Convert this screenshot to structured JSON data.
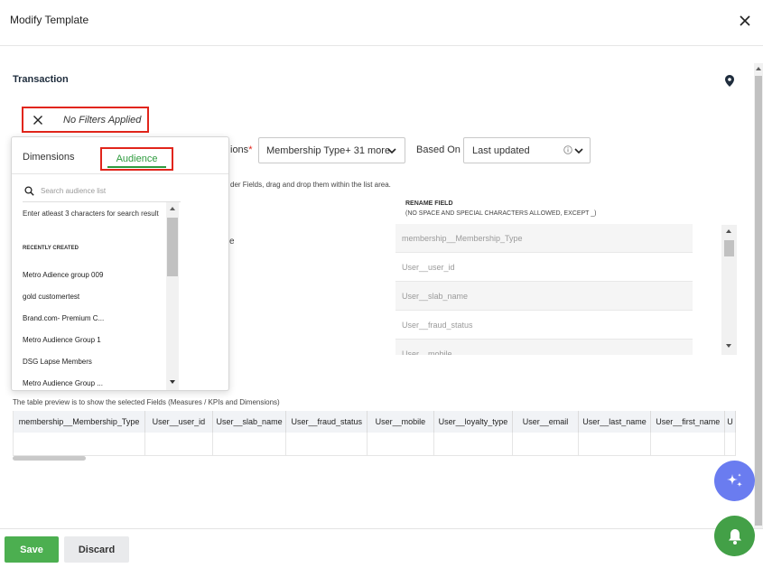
{
  "modal": {
    "title": "Modify Template"
  },
  "section": {
    "title": "Transaction"
  },
  "filter": {
    "label": "No Filters Applied"
  },
  "dimensions_field": {
    "label_fragment": "ions",
    "required_mark": "*",
    "value": "Membership Type+ 31 more"
  },
  "based_on": {
    "label": "Based On",
    "value": "Last updated"
  },
  "hint_text": "der Fields, drag and drop them within the list area.",
  "left_fragment": "e",
  "rename": {
    "title": "RENAME FIELD",
    "subtitle": "(NO SPACE AND SPECIAL CHARACTERS ALLOWED, EXCEPT _)",
    "rows": [
      "membership__Membership_Type",
      "User__user_id",
      "User__slab_name",
      "User__fraud_status",
      "User__mobile"
    ]
  },
  "preview": {
    "note": "The table preview is to show the selected Fields (Measures / KPIs and Dimensions)",
    "columns": [
      "membership__Membership_Type",
      "User__user_id",
      "User__slab_name",
      "User__fraud_status",
      "User__mobile",
      "User__loyalty_type",
      "User__email",
      "User__last_name",
      "User__first_name",
      "U"
    ]
  },
  "dropdown": {
    "tabs": {
      "dimensions": "Dimensions",
      "audience": "Audience"
    },
    "search_placeholder": "Search audience list",
    "hint": "Enter atleast 3 characters for search result",
    "recent_label": "RECENTLY CREATED",
    "items": [
      "Metro Adience group 009",
      "gold customertest",
      "Brand.com- Premium C...",
      "Metro Audience Group 1",
      "DSG Lapse Members",
      "Metro Audience Group ..."
    ]
  },
  "footer": {
    "save": "Save",
    "discard": "Discard"
  },
  "colors": {
    "accent_green": "#4caf50",
    "highlight_red": "#e1251b",
    "ai_fab": "#6a7cf0",
    "bell_fab": "#43a047"
  }
}
